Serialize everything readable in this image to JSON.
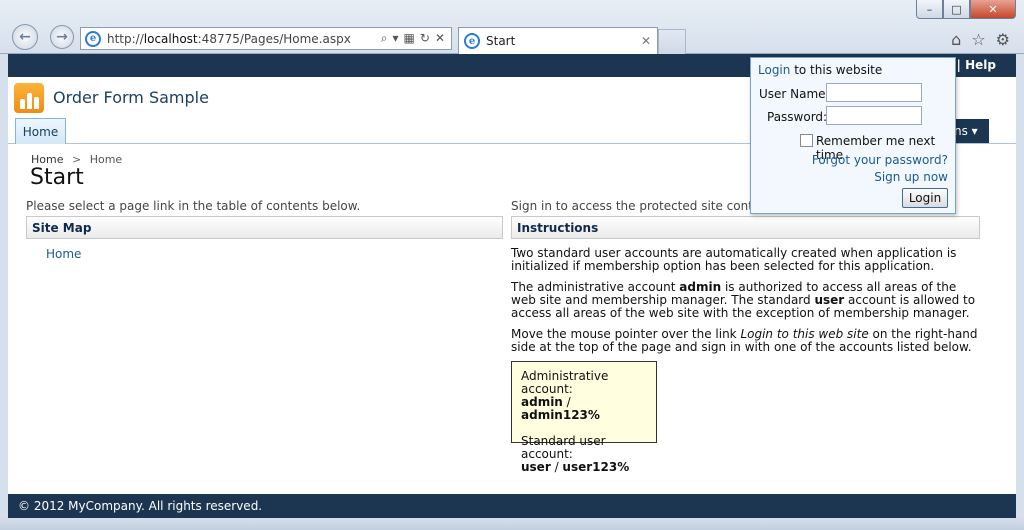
{
  "browser": {
    "address": "http://localhost:48775/Pages/Home.aspx",
    "address_host": "localhost",
    "address_prefix": "http://",
    "address_rest": ":48775/Pages/Home.aspx",
    "tab_title": "Start",
    "window_buttons": [
      "–",
      "□",
      "✕"
    ]
  },
  "topbar": {
    "help_prefix": "| ",
    "help_label": "Help"
  },
  "header": {
    "app_title": "Order Form Sample",
    "home_tab": "Home",
    "actions_tab": "ns ▾"
  },
  "breadcrumb": {
    "items": [
      "Home",
      "Home"
    ],
    "separator": ">"
  },
  "page_title": "Start",
  "left": {
    "intro": "Please select a page link in the table of contents below.",
    "panel_title": "Site Map",
    "links": [
      "Home"
    ]
  },
  "right": {
    "intro": "Sign in to access the protected site content.",
    "panel_title": "Instructions",
    "p1": "Two standard user accounts are automatically created when application is initialized if membership option has been selected for this application.",
    "p2_a": "The administrative account ",
    "p2_b": "admin",
    "p2_c": " is authorized to access all areas of the web site and membership manager. The standard ",
    "p2_d": "user",
    "p2_e": " account is allowed to access all areas of the web site with the exception of membership manager.",
    "p3_a": "Move the mouse pointer over the link ",
    "p3_b": "Login to this web site",
    "p3_c": " on the right-hand side at the top of the page and sign in with one of the accounts listed below.",
    "admin_label": "Administrative account:",
    "admin_user": "admin",
    "admin_sep": " / ",
    "admin_pass": "admin123%",
    "user_label": "Standard user account:",
    "user_user": "user",
    "user_sep": " / ",
    "user_pass": "user123%"
  },
  "login": {
    "link": "Login",
    "header_rest": " to this website",
    "username_label": "User Name:",
    "password_label": "Password:",
    "username_value": "",
    "password_value": "",
    "remember_label": "Remember me next time",
    "forgot": "Forgot your password?",
    "signup": "Sign up now",
    "button": "Login"
  },
  "footer": {
    "text": "© 2012 MyCompany. All rights reserved."
  },
  "colors": {
    "navy": "#1c3551",
    "link": "#1d5a94",
    "account_box": "#ffffe0",
    "logo": "#f08c14"
  }
}
